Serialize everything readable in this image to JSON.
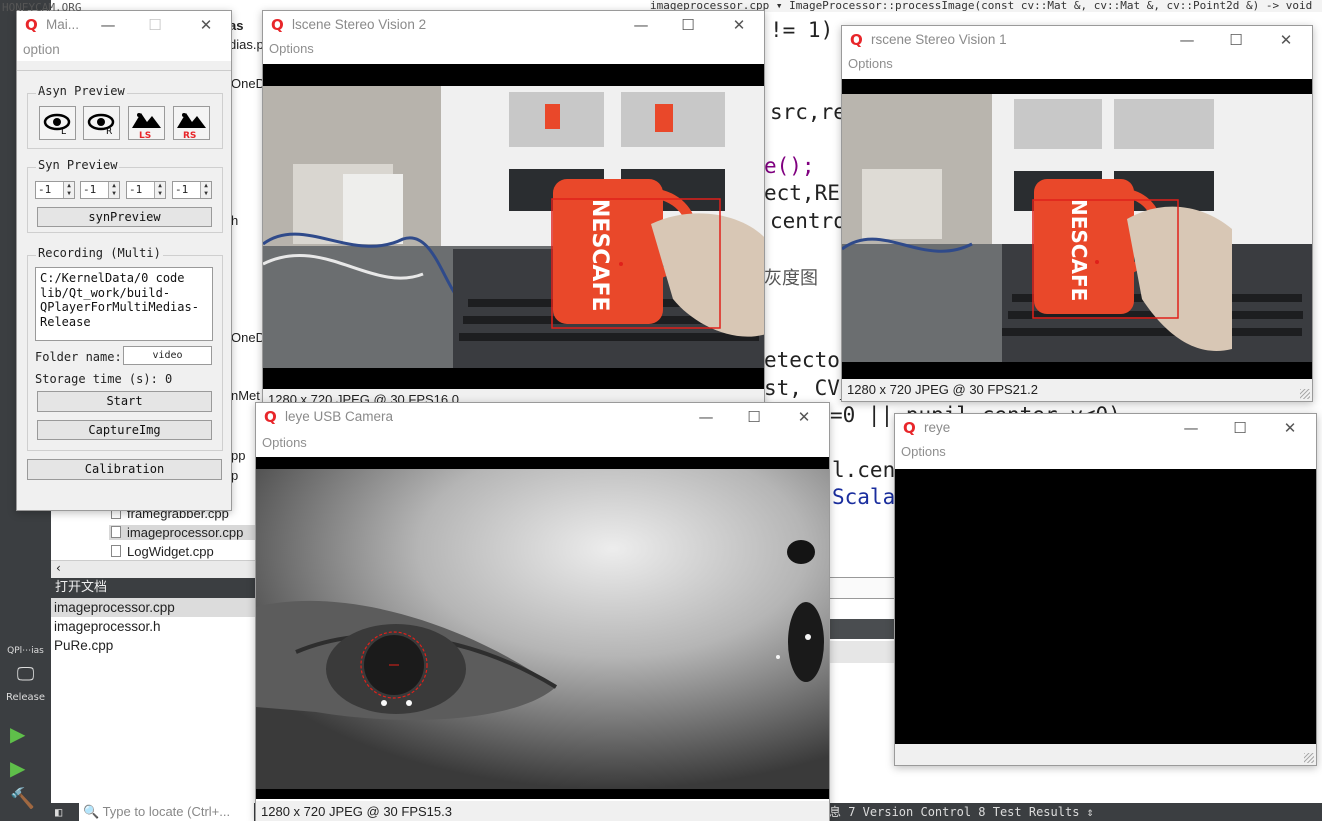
{
  "watermark": "HONEYCAM.ORG",
  "ide": {
    "editor_path": "imageprocessor.cpp  ▾  ImageProcessor::processImage(const cv::Mat &, cv::Mat &, cv::Point2d &) -> void",
    "tree_fragments": [
      "as",
      "dias.p",
      "OneD",
      "h",
      "OneD",
      "nMet",
      "pp",
      "p"
    ],
    "tree_files": [
      "framegrabber.cpp",
      "imageprocessor.cpp",
      "LogWidget.cpp"
    ],
    "open_docs_title": "打开文档",
    "open_docs": [
      "imageprocessor.cpp",
      "imageprocessor.h",
      "PuRe.cpp"
    ],
    "code_fragments": {
      "c1": "!= 1)",
      "c2": "src,re",
      "c3": "e();",
      "c4": "ect,RE",
      "c5": "centro",
      "c6": "灰度图",
      "c7": "etecto",
      "c8": "st, CV_",
      "c9": "=0 ||  pupil center y<0)",
      "c10": "l.cen",
      "c11": "Scala"
    },
    "left_bar": {
      "kit": "QPl⋯ias",
      "config": "Release"
    },
    "locator_placeholder": "Type to locate (Ctrl+...",
    "status_tabs": "息  7 Version Control  8 Test Results  ⇕"
  },
  "main_window": {
    "title": "Mai...",
    "menu": "option",
    "asyn_title": "Asyn Preview",
    "asyn_buttons": [
      {
        "icon": "eye-left-icon",
        "badge": "L"
      },
      {
        "icon": "eye-right-icon",
        "badge": "R"
      },
      {
        "icon": "left-scene-icon",
        "badge": "LS"
      },
      {
        "icon": "right-scene-icon",
        "badge": "RS"
      }
    ],
    "syn_title": "Syn Preview",
    "spin_values": [
      "-1",
      "-1",
      "-1",
      "-1"
    ],
    "syn_button": "synPreview",
    "recording_title": "Recording (Multi)",
    "path_text": "C:/KernelData/0 code\nlib/Qt_work/build-\nQPlayerForMultiMedias-\nRelease",
    "folder_label": "Folder name:",
    "folder_value": "video",
    "storage_label": "Storage time (s): 0",
    "start_button": "Start",
    "capture_button": "CaptureImg",
    "calibration_button": "Calibration"
  },
  "windows": {
    "lscene": {
      "title": "lscene Stereo Vision 2",
      "menu": "Options",
      "status": "1280 x 720 JPEG @ 30 FPS16.0"
    },
    "rscene": {
      "title": "rscene Stereo Vision 1",
      "menu": "Options",
      "status": "1280 x 720 JPEG @ 30 FPS21.2"
    },
    "leye": {
      "title": "leye USB Camera",
      "menu": "Options",
      "status": "1280 x 720 JPEG @ 30 FPS15.3"
    },
    "reye": {
      "title": "reye",
      "menu": "Options"
    }
  },
  "scene": {
    "mug_brand": "NESCAFE"
  },
  "colors": {
    "qt_red": "#e8262a",
    "detect_box": "#e0201a",
    "mug": "#e9482a"
  }
}
